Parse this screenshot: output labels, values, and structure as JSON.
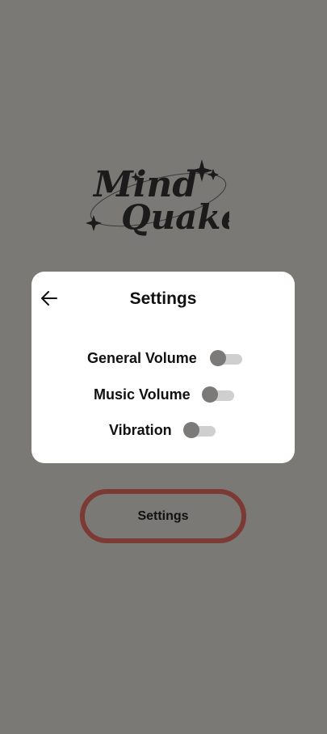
{
  "logo": {
    "line1": "Mind",
    "line2": "Quake"
  },
  "dialog": {
    "title": "Settings",
    "back_icon": "arrow-left-icon",
    "settings": [
      {
        "label": "General Volume",
        "enabled": false
      },
      {
        "label": "Music Volume",
        "enabled": false
      },
      {
        "label": "Vibration",
        "enabled": false
      }
    ]
  },
  "menu": {
    "button_label": "Settings"
  },
  "colors": {
    "background": "#7b7975",
    "dialog": "#ffffff",
    "button_border": "#7b3a34",
    "toggle_thumb": "#7b7a79",
    "toggle_track": "#cfcfcf"
  }
}
